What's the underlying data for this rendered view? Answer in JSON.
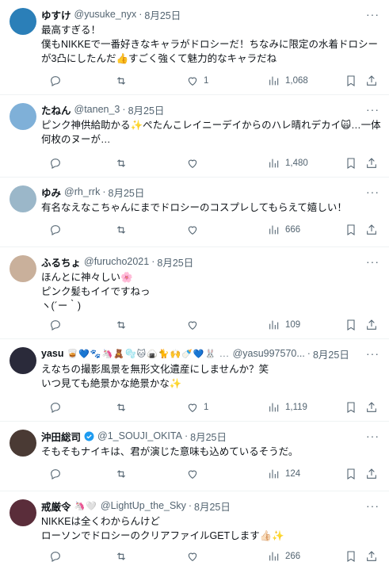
{
  "tweets": [
    {
      "name": "ゆすけ",
      "handle": "@yusuke_nyx",
      "time": "8月25日",
      "text": "最高すぎる！\n僕もNIKKEで一番好きなキャラがドロシーだ！ちなみに限定の水着ドロシーが3凸にしたんだ👍すごく強くて魅力的なキャラだね",
      "likes": "1",
      "views": "1,068",
      "avatar_color": "#2b7fb8"
    },
    {
      "name": "たねん",
      "handle": "@tanen_3",
      "time": "8月25日",
      "text": "ピンク神供給助かる✨ぺたんこレイニーデイからのハレ晴れデカイ🙀…一体何枚のヌーが…",
      "likes": "",
      "views": "1,480",
      "avatar_color": "#7fb0d8"
    },
    {
      "name": "ゆみ",
      "handle": "@rh_rrk",
      "time": "8月25日",
      "text": "有名なえなこちゃんにまでドロシーのコスプレしてもらえて嬉しい！",
      "likes": "",
      "views": "666",
      "avatar_color": "#9bb7c9"
    },
    {
      "name": "ふるちょ",
      "handle": "@furucho2021",
      "time": "8月25日",
      "text": "ほんとに神々しい🌸\nピンク髪もイイですねっ\n ヽ(´ー｀)",
      "likes": "",
      "views": "109",
      "avatar_color": "#c9b09b"
    },
    {
      "name": "yasu",
      "handle": "@yasu997570...",
      "time": "8月25日",
      "deco": "🥃💙🐾🦄🧸🫧🐱🍙🐈🙌🍼💙🐰 ...",
      "text": "えなちの撮影風景を無形文化遺産にしませんか？笑\nいつ見ても絶景かな絶景かな✨",
      "likes": "1",
      "views": "1,119",
      "avatar_color": "#2a2a3a"
    },
    {
      "name": "沖田総司",
      "handle": "@1_SOUJI_OKITA",
      "time": "8月25日",
      "text": "そもそもナイキは、君が演じた意味も込めているそうだ。",
      "likes": "",
      "views": "124",
      "avatar_color": "#4a3a34",
      "verified": true
    },
    {
      "name": "戒厳令",
      "handle": "@LightUp_the_Sky",
      "time": "8月25日",
      "deco": "🦄🤍",
      "text": "NIKKEは全くわからんけど\nローソンでドロシーのクリアファイルGETします👍🏻✨",
      "likes": "",
      "views": "266",
      "avatar_color": "#5a2d3a"
    }
  ],
  "colors": {
    "text": "#0f1419",
    "muted": "#536471",
    "divider": "#eff3f4",
    "verified": "#1d9bf0"
  }
}
